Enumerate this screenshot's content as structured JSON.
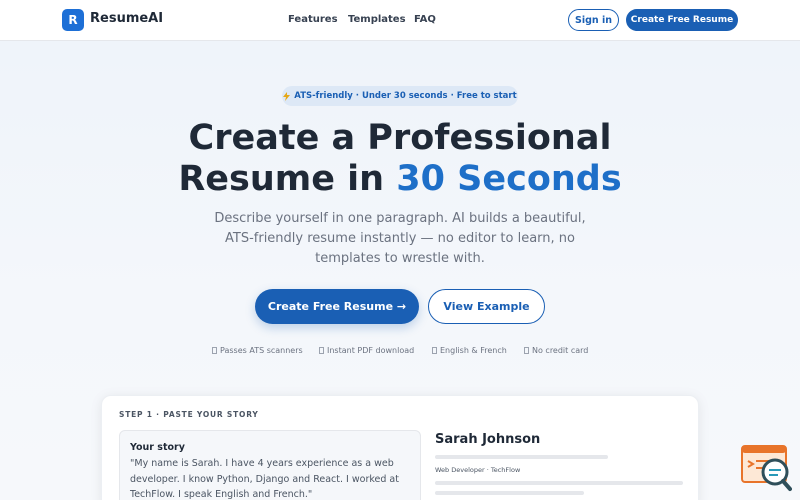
{
  "nav": {
    "logo_letter": "R",
    "brand": "ResumeAI",
    "links": [
      "Features",
      "Templates",
      "FAQ"
    ],
    "signin_label": "Sign in",
    "cta_label": "Create Free Resume"
  },
  "hero": {
    "badge": "ATS-friendly · Under 30 seconds · Free to start",
    "badge_icon": "lightning-icon",
    "title_line1": "Create a Professional",
    "title_line2_prefix": "Resume in ",
    "title_line2_accent": "30 Seconds",
    "subtitle": "Describe yourself in one paragraph. AI builds a beautiful, ATS-friendly resume instantly — no editor to learn, no templates to wrestle with.",
    "primary_cta": "Create Free Resume →",
    "secondary_cta": "View Example",
    "features": [
      "Passes ATS scanners",
      "Instant PDF download",
      "English & French",
      "No credit card"
    ]
  },
  "demo": {
    "step_label": "STEP 1 · PASTE YOUR STORY",
    "story_title": "Your story",
    "story_text": "\"My name is Sarah. I have 4 years experience as a web developer. I know Python, Django and React. I worked at TechFlow. I speak English and French.\"",
    "preview_name": "Sarah Johnson",
    "preview_role": "Web Developer · TechFlow"
  },
  "colors": {
    "primary": "#1a5fb4",
    "accent": "#1e6fc8",
    "widget": "#e8742a"
  },
  "widget_icon": "search-assistant-icon"
}
